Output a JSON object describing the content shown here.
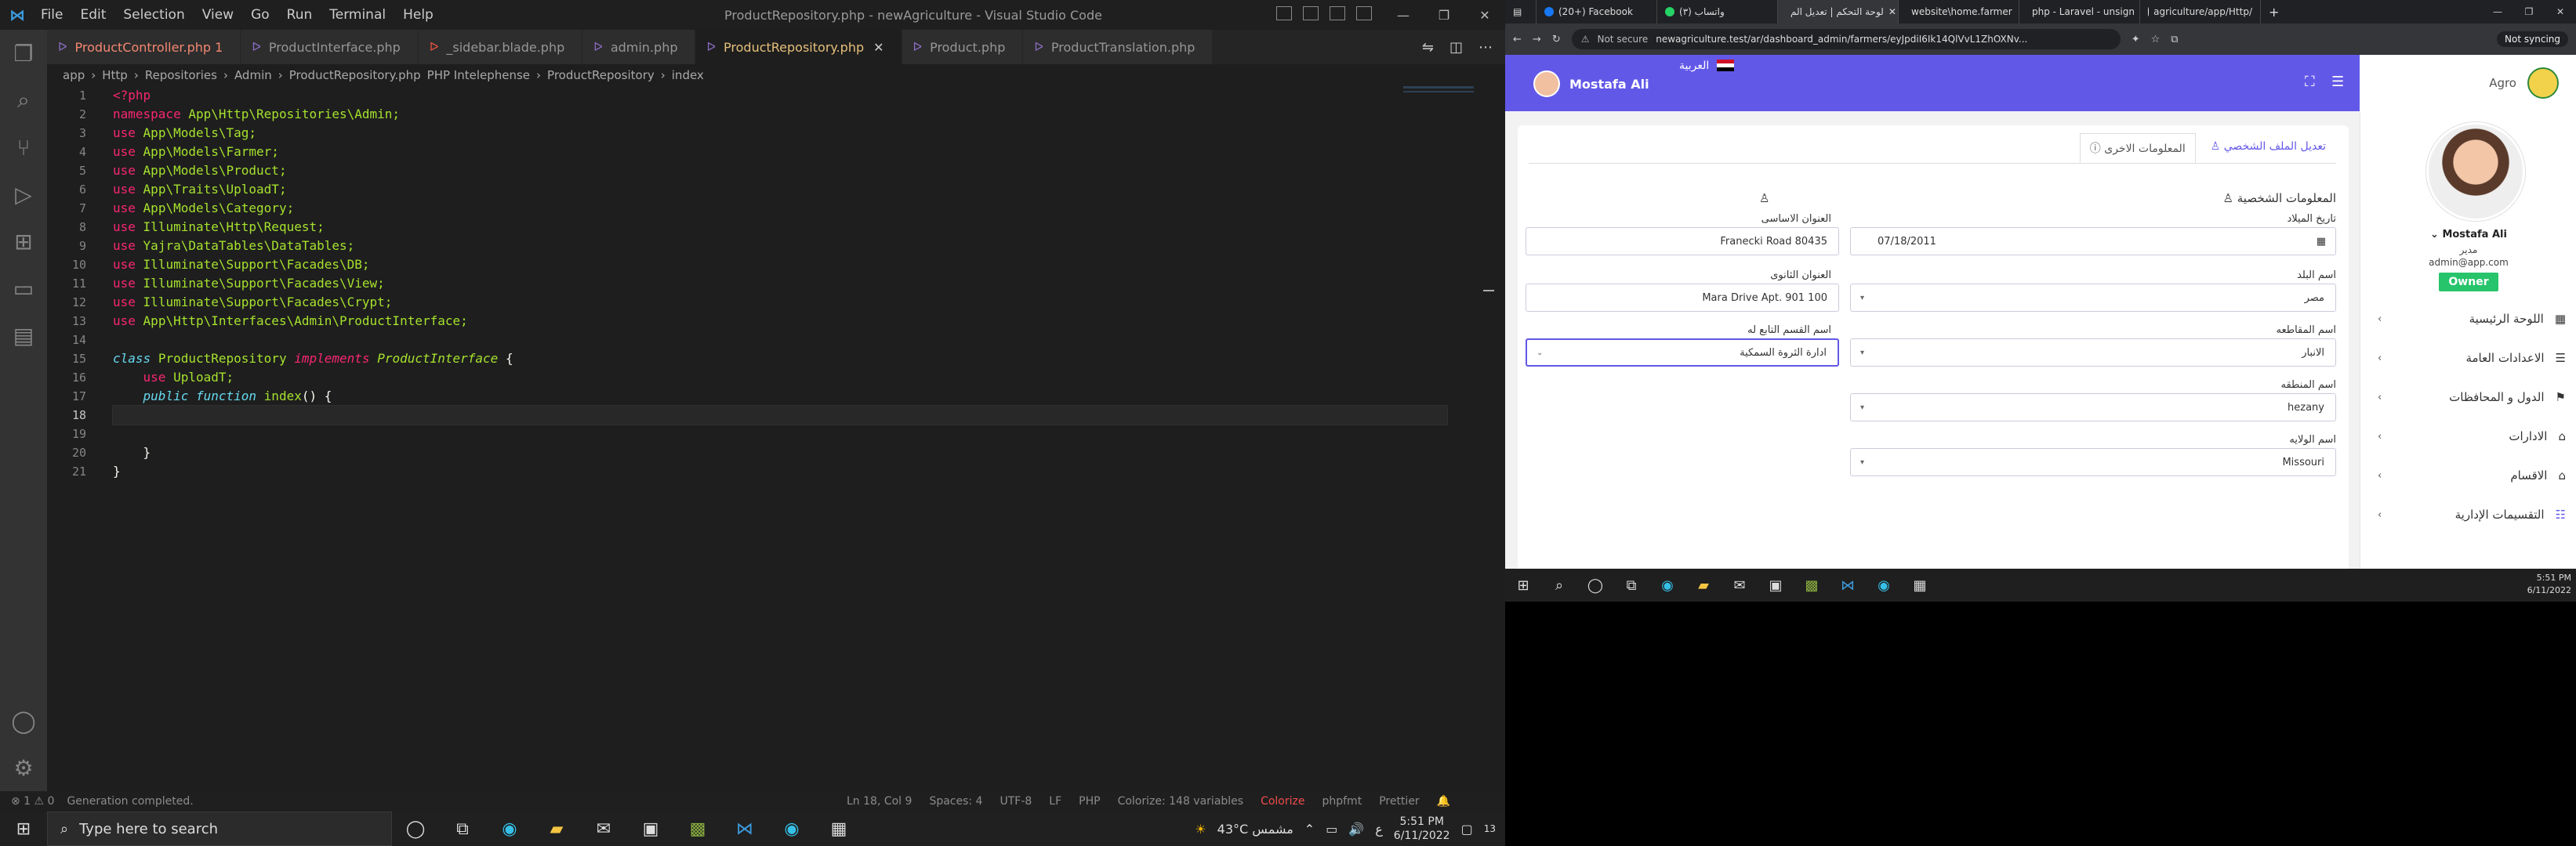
{
  "vscode": {
    "title": "ProductRepository.php - newAgriculture - Visual Studio Code",
    "menus": [
      "File",
      "Edit",
      "Selection",
      "View",
      "Go",
      "Run",
      "Terminal",
      "Help"
    ],
    "tabs": [
      {
        "label": "ProductController.php",
        "suffix": "1"
      },
      {
        "label": "ProductInterface.php"
      },
      {
        "label": "_sidebar.blade.php"
      },
      {
        "label": "admin.php"
      },
      {
        "label": "ProductRepository.php"
      },
      {
        "label": "Product.php"
      },
      {
        "label": "ProductTranslation.php"
      }
    ],
    "breadcrumb": [
      "app",
      "Http",
      "Repositories",
      "Admin",
      "ProductRepository.php",
      "PHP Intelephense",
      "ProductRepository",
      "index"
    ],
    "lines": [
      "1",
      "2",
      "3",
      "4",
      "5",
      "6",
      "7",
      "8",
      "9",
      "10",
      "11",
      "12",
      "13",
      "14",
      "15",
      "16",
      "17",
      "18",
      "19",
      "20",
      "21"
    ],
    "code": {
      "open": "<?php",
      "ns_kw": "namespace",
      "ns": "App\\Http\\Repositories\\Admin;",
      "u3": "App\\Models\\Tag;",
      "u4": "App\\Models\\Farmer;",
      "u5": "App\\Models\\Product;",
      "u6": "App\\Traits\\UploadT;",
      "u7": "App\\Models\\Category;",
      "u8": "Illuminate\\Http\\Request;",
      "u9": "Yajra\\DataTables\\DataTables;",
      "u10": "Illuminate\\Support\\Facades\\DB;",
      "u11": "Illuminate\\Support\\Facades\\View;",
      "u12": "Illuminate\\Support\\Facades\\Crypt;",
      "u13": "App\\Http\\Interfaces\\Admin\\ProductInterface;",
      "use": "use",
      "class_kw": "class",
      "class_name": "ProductRepository",
      "implements": "implements",
      "iface": "ProductInterface",
      "use_trait": "UploadT;",
      "public": "public",
      "function": "function",
      "method": "index",
      "parens": "() {",
      "brace_open": "{",
      "brace_close": "}"
    },
    "status": {
      "problems": "⊗ 1  ⚠ 0",
      "message": "Generation completed.",
      "position": "Ln 18, Col 9",
      "spaces": "Spaces: 4",
      "encoding": "UTF-8",
      "eol": "LF",
      "language": "PHP",
      "colorize_vars": "Colorize: 148 variables",
      "colorize": "Colorize",
      "phpfmt": "phpfmt",
      "prettier": "Prettier"
    }
  },
  "taskbar": {
    "search_placeholder": "Type here to search",
    "weather": "43°C  مشمس",
    "time": "5:51 PM",
    "date": "6/11/2022",
    "lang": "ع",
    "notif": "13"
  },
  "browser": {
    "tabs": [
      "(20+) Facebook",
      "(٣) واتساب",
      "لوحة التحكم | تعديل الم",
      "website\\home.farmer",
      "php - Laravel - unsign",
      "agriculture/app/Http/"
    ],
    "not_secure": "Not secure",
    "url": "newagriculture.test/ar/dashboard_admin/farmers/eyJpdiI6Ik14QlVvL1ZhOXNv...",
    "sync": "Not syncing",
    "clock_time": "5:51 PM",
    "clock_date": "6/11/2022"
  },
  "dashboard": {
    "user_name": "Mostafa Ali",
    "lang_label": "العربية",
    "brand": "Agro",
    "tab_edit_profile": "تعديل الملف الشخصي",
    "tab_other_info": "المعلومات الاخرى",
    "section_personal": "المعلومات الشخصية",
    "fields": {
      "dob_label": "تاريخ الميلاد",
      "dob_value": "07/18/2011",
      "addr1_label": "العنوان الاساسى",
      "addr1_value": "Franecki Road 80435",
      "country_label": "اسم البلد",
      "country_value": "مصر",
      "addr2_label": "العنوان الثانوى",
      "addr2_value": "Mara Drive Apt. 901 100",
      "province_label": "اسم المقاطعه",
      "province_value": "الانبار",
      "section_label": "اسم القسم التابع له",
      "section_value": "ادارة الثروة السمكية",
      "region_label": "اسم المنطقه",
      "region_value": "hezany",
      "state_label": "اسم الولايه",
      "state_value": "Missouri"
    },
    "sidebar": {
      "name": "Mostafa Ali",
      "role": "مدير",
      "email": "admin@app.com",
      "badge": "Owner",
      "items": [
        "اللوحة الرئيسية",
        "الاعدادات العامة",
        "الدول و المحافظات",
        "الادارات",
        "الاقسام",
        "التقسيمات الإدارية"
      ]
    }
  }
}
